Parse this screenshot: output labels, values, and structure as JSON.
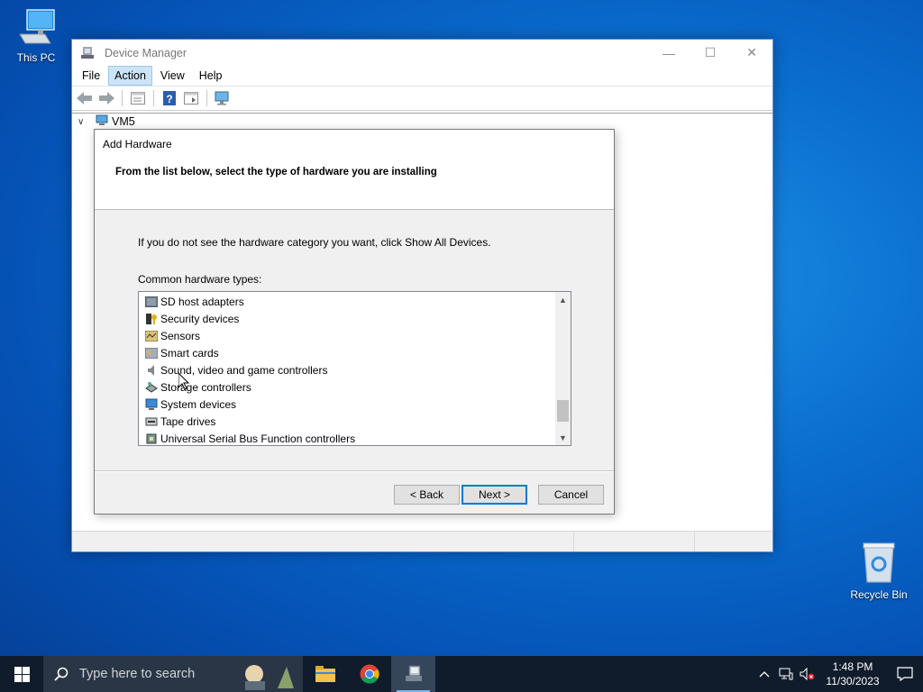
{
  "desktop": {
    "icons": [
      {
        "label": "This PC"
      },
      {
        "label": "Recycle Bin"
      }
    ]
  },
  "device_manager": {
    "title": "Device Manager",
    "menu": [
      "File",
      "Action",
      "View",
      "Help"
    ],
    "active_menu": "Action",
    "tree_root": "VM5"
  },
  "dialog": {
    "title": "Add Hardware",
    "heading": "From the list below, select the type of hardware you are installing",
    "instruction": "If you do not see the hardware category you want, click Show All Devices.",
    "list_label": "Common hardware types:",
    "items": [
      {
        "label": "SD host adapters",
        "icon": "sd-adapter-icon"
      },
      {
        "label": "Security devices",
        "icon": "security-device-icon"
      },
      {
        "label": "Sensors",
        "icon": "sensor-icon"
      },
      {
        "label": "Smart cards",
        "icon": "smart-card-icon"
      },
      {
        "label": "Sound, video and game controllers",
        "icon": "speaker-icon"
      },
      {
        "label": "Storage controllers",
        "icon": "storage-controller-icon"
      },
      {
        "label": "System devices",
        "icon": "system-device-icon"
      },
      {
        "label": "Tape drives",
        "icon": "tape-drive-icon"
      },
      {
        "label": "Universal Serial Bus Function controllers",
        "icon": "usb-icon"
      }
    ],
    "buttons": {
      "back": "< Back",
      "next": "Next >",
      "cancel": "Cancel"
    }
  },
  "taskbar": {
    "search_placeholder": "Type here to search",
    "apps": [
      "file-explorer-icon",
      "chrome-icon",
      "device-manager-icon"
    ],
    "clock": {
      "time": "1:48 PM",
      "date": "11/30/2023"
    }
  },
  "colors": {
    "accent": "#0078d7",
    "menu_highlight": "#cce4f7",
    "taskbar": "#101c2c"
  }
}
